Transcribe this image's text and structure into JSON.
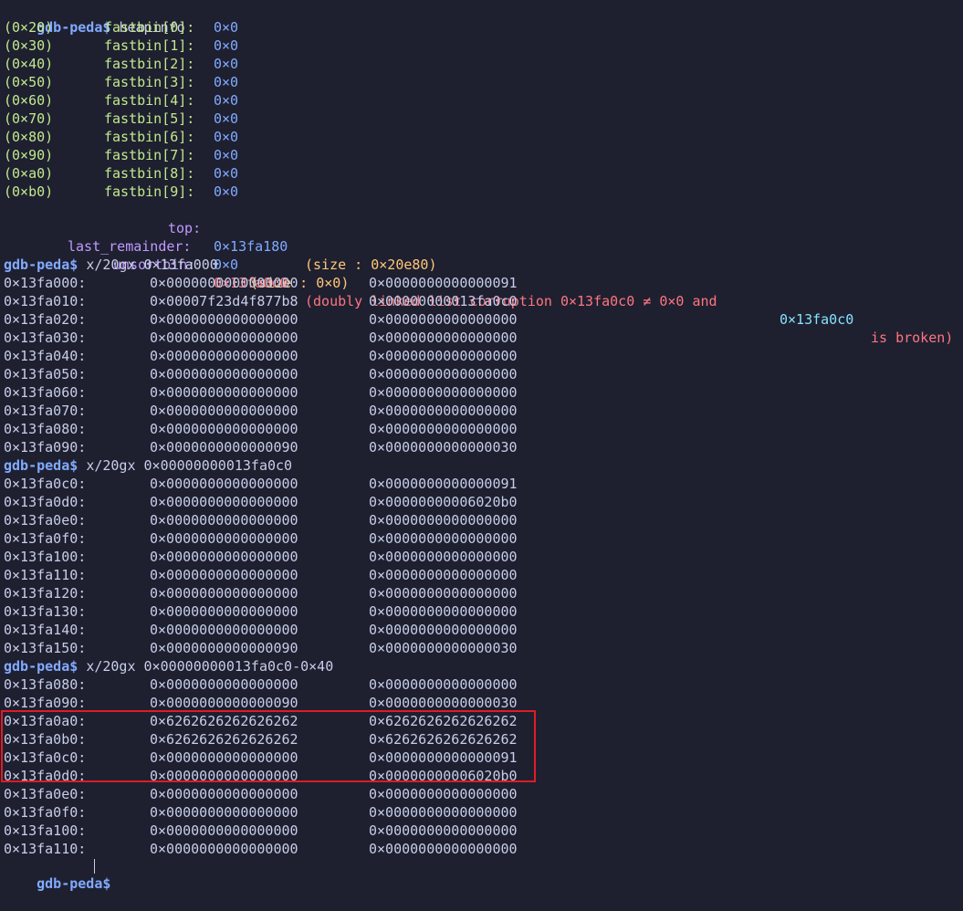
{
  "prompt": "gdb-peda$",
  "heapinfo": {
    "command": "heapinfo",
    "fastbins": [
      {
        "size": "(0×20)",
        "label": "fastbin[0]:",
        "value": "0×0"
      },
      {
        "size": "(0×30)",
        "label": "fastbin[1]:",
        "value": "0×0"
      },
      {
        "size": "(0×40)",
        "label": "fastbin[2]:",
        "value": "0×0"
      },
      {
        "size": "(0×50)",
        "label": "fastbin[3]:",
        "value": "0×0"
      },
      {
        "size": "(0×60)",
        "label": "fastbin[4]:",
        "value": "0×0"
      },
      {
        "size": "(0×70)",
        "label": "fastbin[5]:",
        "value": "0×0"
      },
      {
        "size": "(0×80)",
        "label": "fastbin[6]:",
        "value": "0×0"
      },
      {
        "size": "(0×90)",
        "label": "fastbin[7]:",
        "value": "0×0"
      },
      {
        "size": "(0×a0)",
        "label": "fastbin[8]:",
        "value": "0×0"
      },
      {
        "size": "(0×b0)",
        "label": "fastbin[9]:",
        "value": "0×0"
      }
    ],
    "top": {
      "label": "top:",
      "value": "0×13fa180",
      "size": "(size : 0×20e80)"
    },
    "last_remainder": {
      "label": "last_remainder:",
      "value": "0×0",
      "size": "(size : 0×0)"
    },
    "unsortbin": {
      "label": "unsortbin:",
      "value": "0×13fa0c0",
      "err_pre": "(doubly linked list corruption 0×13fa0c0 ≠ 0×0 and",
      "err_addr": "0×13fa0c0",
      "err_post": "is broken)"
    }
  },
  "dumps": [
    {
      "command": "x/20gx 0×13fa000",
      "rows": [
        [
          "0×13fa000:",
          "0×0000000000000000",
          "0×0000000000000091"
        ],
        [
          "0×13fa010:",
          "0×00007f23d4f877b8",
          "0×00000000013fa0c0"
        ],
        [
          "0×13fa020:",
          "0×0000000000000000",
          "0×0000000000000000"
        ],
        [
          "0×13fa030:",
          "0×0000000000000000",
          "0×0000000000000000"
        ],
        [
          "0×13fa040:",
          "0×0000000000000000",
          "0×0000000000000000"
        ],
        [
          "0×13fa050:",
          "0×0000000000000000",
          "0×0000000000000000"
        ],
        [
          "0×13fa060:",
          "0×0000000000000000",
          "0×0000000000000000"
        ],
        [
          "0×13fa070:",
          "0×0000000000000000",
          "0×0000000000000000"
        ],
        [
          "0×13fa080:",
          "0×0000000000000000",
          "0×0000000000000000"
        ],
        [
          "0×13fa090:",
          "0×0000000000000090",
          "0×0000000000000030"
        ]
      ]
    },
    {
      "command": "x/20gx 0×00000000013fa0c0",
      "rows": [
        [
          "0×13fa0c0:",
          "0×0000000000000000",
          "0×0000000000000091"
        ],
        [
          "0×13fa0d0:",
          "0×0000000000000000",
          "0×00000000006020b0"
        ],
        [
          "0×13fa0e0:",
          "0×0000000000000000",
          "0×0000000000000000"
        ],
        [
          "0×13fa0f0:",
          "0×0000000000000000",
          "0×0000000000000000"
        ],
        [
          "0×13fa100:",
          "0×0000000000000000",
          "0×0000000000000000"
        ],
        [
          "0×13fa110:",
          "0×0000000000000000",
          "0×0000000000000000"
        ],
        [
          "0×13fa120:",
          "0×0000000000000000",
          "0×0000000000000000"
        ],
        [
          "0×13fa130:",
          "0×0000000000000000",
          "0×0000000000000000"
        ],
        [
          "0×13fa140:",
          "0×0000000000000000",
          "0×0000000000000000"
        ],
        [
          "0×13fa150:",
          "0×0000000000000090",
          "0×0000000000000030"
        ]
      ]
    },
    {
      "command": "x/20gx 0×00000000013fa0c0-0×40",
      "rows": [
        [
          "0×13fa080:",
          "0×0000000000000000",
          "0×0000000000000000"
        ],
        [
          "0×13fa090:",
          "0×0000000000000090",
          "0×0000000000000030"
        ],
        [
          "0×13fa0a0:",
          "0×6262626262626262",
          "0×6262626262626262"
        ],
        [
          "0×13fa0b0:",
          "0×6262626262626262",
          "0×6262626262626262"
        ],
        [
          "0×13fa0c0:",
          "0×0000000000000000",
          "0×0000000000000091"
        ],
        [
          "0×13fa0d0:",
          "0×0000000000000000",
          "0×00000000006020b0"
        ],
        [
          "0×13fa0e0:",
          "0×0000000000000000",
          "0×0000000000000000"
        ],
        [
          "0×13fa0f0:",
          "0×0000000000000000",
          "0×0000000000000000"
        ],
        [
          "0×13fa100:",
          "0×0000000000000000",
          "0×0000000000000000"
        ],
        [
          "0×13fa110:",
          "0×0000000000000000",
          "0×0000000000000000"
        ]
      ]
    }
  ],
  "colors": {
    "background": "#1e2030",
    "prompt": "#82aaff",
    "highlight_border": "#e01b24",
    "error": "#ff757f"
  }
}
